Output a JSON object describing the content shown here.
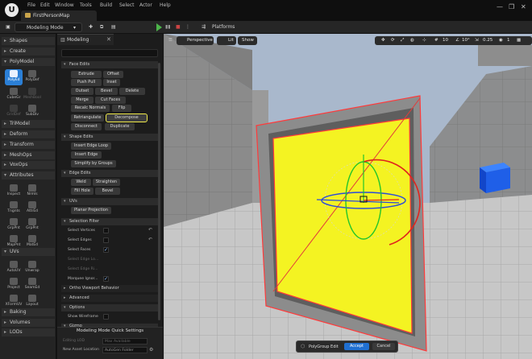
{
  "window": {
    "tab_label": "FirstPersonMap",
    "menu": [
      "File",
      "Edit",
      "Window",
      "Tools",
      "Build",
      "Select",
      "Actor",
      "Help"
    ],
    "controls": [
      "—",
      "❐",
      "✕"
    ]
  },
  "toolbar": {
    "mode_label": "Modeling Mode",
    "platforms_label": "Platforms"
  },
  "left": {
    "categories": [
      "Shapes",
      "Create",
      "PolyModel",
      "TriModel",
      "Deform",
      "Transform",
      "MeshOps",
      "VoxOps",
      "Attributes",
      "UVs",
      "Baking",
      "Volumes",
      "LODs"
    ],
    "polymodel_tools": [
      "PolyEd",
      "PolyDef",
      "CubeGr",
      "MeshBool",
      "GridDef",
      "SubDiv"
    ],
    "attributes_tools": [
      "Inspect",
      "Nrmls",
      "Tngnts",
      "AttrEd",
      "GrpPnt",
      "GrpPnt",
      "MapPnt",
      "MatEd"
    ],
    "uvs_tools": [
      "AutoUV",
      "Unwrap",
      "Project",
      "SeamEd",
      "XFormUV",
      "Layout"
    ]
  },
  "panel": {
    "tab_label": "Modeling",
    "face_edits": {
      "title": "Face Edits",
      "rows": [
        [
          "Extrude",
          "Offset"
        ],
        [
          "Push Pull",
          "Inset"
        ],
        [
          "Outset",
          "Bevel",
          "Delete"
        ],
        [
          "Merge",
          "Cut Faces"
        ],
        [
          "Recalc Normals",
          "Flip"
        ],
        [
          "Retriangulate",
          "Decompose"
        ],
        [
          "Disconnect",
          "Duplicate"
        ]
      ]
    },
    "shape_edits": {
      "title": "Shape Edits",
      "buttons": [
        "Insert Edge Loop",
        "Insert Edge",
        "Simplify by Groups"
      ]
    },
    "edge_edits": {
      "title": "Edge Edits",
      "buttons": [
        "Weld",
        "Straighten",
        "Fill Hole",
        "Bevel"
      ]
    },
    "uvs": {
      "title": "UVs",
      "buttons": [
        "Planar Projection"
      ]
    },
    "selection_filter": {
      "title": "Selection Filter",
      "rows": [
        "Select Vertices",
        "Select Edges",
        "Select Faces",
        "Select Edge Lo...",
        "Select Edge Ri...",
        "Marquee Ignor..."
      ]
    },
    "ortho_label": "Ortho Viewport Behavior",
    "advanced_label": "Advanced",
    "options": {
      "title": "Options",
      "rows": [
        "Show Wireframe"
      ]
    },
    "gizmo_label": "Gizmo",
    "quick": {
      "title": "Modeling Mode Quick Settings",
      "editing_lod_label": "Editing LOD",
      "editing_lod_value": "Max Available",
      "asset_location_label": "New Asset Location",
      "asset_location_value": "AutoGen Folder"
    }
  },
  "viewport": {
    "perspective_label": "Perspective",
    "lit_label": "Lit",
    "show_label": "Show",
    "angle_value": "10°",
    "speed_value": "0.25",
    "layout_value": "1",
    "popup_label": "PolyGroup Edit",
    "accept_label": "Accept",
    "cancel_label": "Cancel"
  }
}
